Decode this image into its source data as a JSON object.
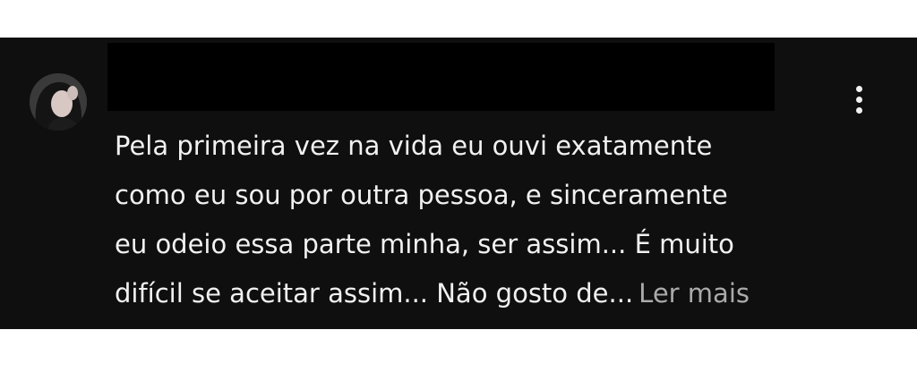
{
  "comment": {
    "author_redacted": true,
    "text_lines": [
      "Pela primeira vez na vida eu ouvi exatamente",
      "como eu sou por outra pessoa, e sinceramente",
      "eu odeio essa parte minha, ser assim... É muito",
      "difícil se aceitar assim... Não gosto de..."
    ],
    "read_more_label": "Ler mais",
    "menu_icon": "more-vert-icon"
  },
  "colors": {
    "background": "#0f0f0f",
    "text": "#f1f1f1",
    "read_more": "#aaaaaa",
    "redaction": "#000000"
  }
}
